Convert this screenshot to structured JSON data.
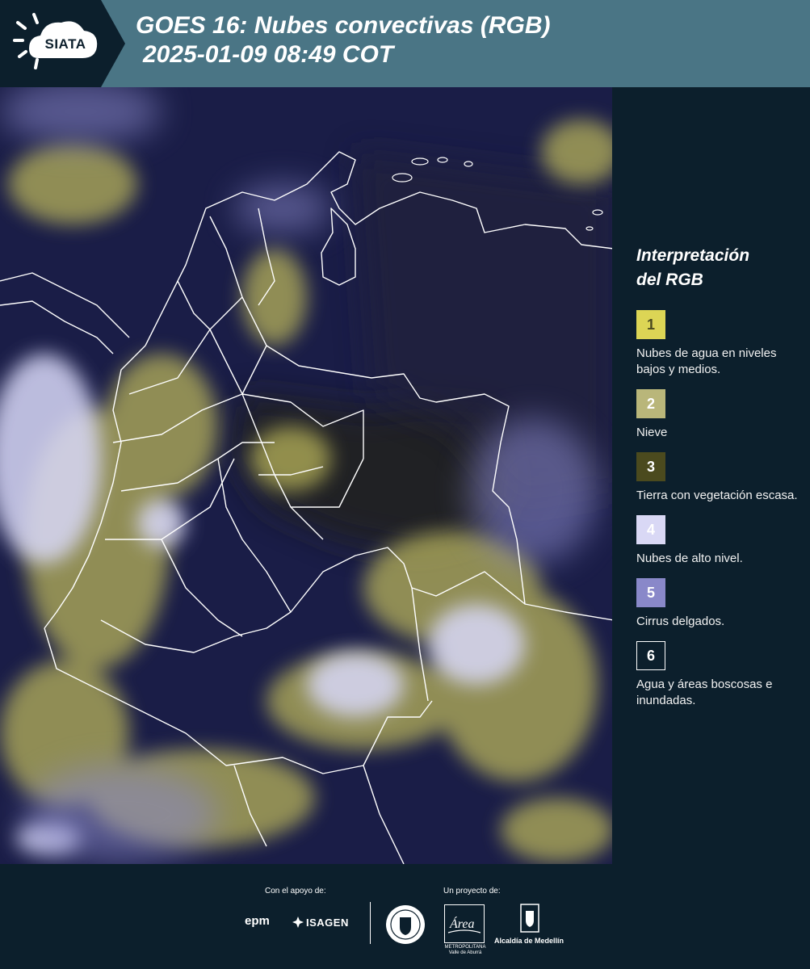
{
  "header": {
    "brand": "SIATA",
    "title_line1": "GOES 16: Nubes convectivas (RGB)",
    "title_line2": "2025-01-09 08:49 COT",
    "band_color": "#4a7585",
    "dark_color": "#0c1f2c"
  },
  "legend": {
    "title_line1": "Interpretación",
    "title_line2": "del RGB",
    "items": [
      {
        "number": "1",
        "label": "Nubes de agua en niveles bajos y medios.",
        "color": "#dcd555",
        "text_color": "#4a4a20"
      },
      {
        "number": "2",
        "label": "Nieve",
        "color": "#b9b67a",
        "text_color": "#ffffff"
      },
      {
        "number": "3",
        "label": "Tierra con vegetación escasa.",
        "color": "#4b4a1e",
        "text_color": "#ffffff"
      },
      {
        "number": "4",
        "label": "Nubes de alto nivel.",
        "color": "#d9d8f5",
        "text_color": "#ffffff"
      },
      {
        "number": "5",
        "label": "Cirrus delgados.",
        "color": "#8988c9",
        "text_color": "#ffffff"
      },
      {
        "number": "6",
        "label": "Agua y áreas boscosas e inundadas.",
        "color": "#0c1f2c",
        "text_color": "#ffffff"
      }
    ]
  },
  "footer": {
    "support_caption": "Con el apoyo de:",
    "project_caption": "Un proyecto de:",
    "sponsor_epm": "epm",
    "sponsor_isagen": "ISAGEN",
    "area_logo_text": "Área",
    "area_caption": "METROPOLITANA Valle de Aburrá",
    "alcaldia": "Alcaldía de Medellín"
  },
  "map": {
    "icon": "satellite-map",
    "colors": {
      "background": "#1a1d47",
      "yellow_cloud": "#c9c35c",
      "high_cloud": "#d8d8f8",
      "border": "#ffffff"
    }
  }
}
